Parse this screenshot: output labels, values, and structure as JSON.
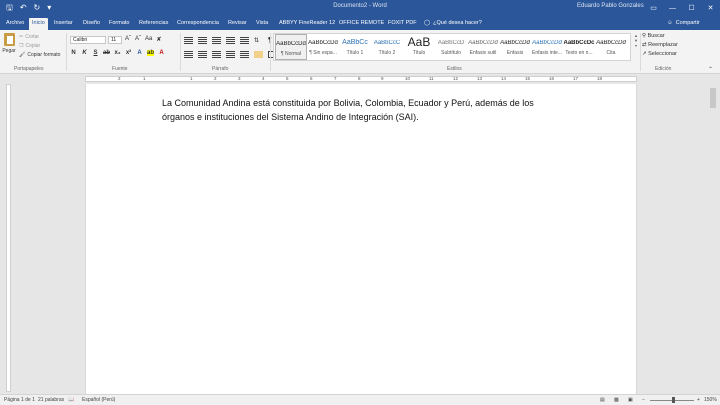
{
  "titlebar": {
    "doc_title": "Documento2 - Word",
    "user": "Eduardo Pablo Gonzales",
    "qat_icons": [
      "save-icon",
      "undo-icon",
      "redo-icon",
      "customize-icon"
    ],
    "controls": [
      "▭",
      "—",
      "☐",
      "✕"
    ]
  },
  "tabs": [
    {
      "label": "Archivo"
    },
    {
      "label": "Inicio"
    },
    {
      "label": "Insertar"
    },
    {
      "label": "Diseño"
    },
    {
      "label": "Formato"
    },
    {
      "label": "Referencias"
    },
    {
      "label": "Correspondencia"
    },
    {
      "label": "Revisar"
    },
    {
      "label": "Vista"
    },
    {
      "label": "ABBYY FineReader 12"
    },
    {
      "label": "OFFICE REMOTE"
    },
    {
      "label": "FOXIT PDF"
    }
  ],
  "tell_me": "¿Qué desea hacer?",
  "share": "Compartir",
  "clipboard": {
    "paste": "Pegar",
    "cut": "Cortar",
    "copy": "Copiar",
    "format_painter": "Copiar formato",
    "group": "Portapapeles"
  },
  "font": {
    "name": "Calibri",
    "size": "11",
    "group": "Fuente",
    "bold": "N",
    "italic": "K",
    "underline": "S"
  },
  "paragraph": {
    "group": "Párrafo"
  },
  "styles": {
    "group": "Estilos",
    "items": [
      {
        "sample": "AaBbCcDd",
        "name": "¶ Normal"
      },
      {
        "sample": "AaBbCcDd",
        "name": "¶ Sin espa..."
      },
      {
        "sample": "AaBbCc",
        "name": "Título 1"
      },
      {
        "sample": "AaBbCcC",
        "name": "Título 2"
      },
      {
        "sample": "AaB",
        "name": "Título"
      },
      {
        "sample": "AaBbCcD",
        "name": "Subtítulo"
      },
      {
        "sample": "AaBbCcDd",
        "name": "Énfasis sutil"
      },
      {
        "sample": "AaBbCcDd",
        "name": "Énfasis"
      },
      {
        "sample": "AaBbCcDd",
        "name": "Énfasis inte..."
      },
      {
        "sample": "AaBbCcDc",
        "name": "Texto en n..."
      },
      {
        "sample": "AaBbCcDd",
        "name": "Cita"
      }
    ]
  },
  "editing": {
    "find": "Buscar",
    "replace": "Reemplazar",
    "select": "Seleccionar",
    "group": "Edición"
  },
  "ruler_numbers": [
    "2",
    "1",
    "1",
    "2",
    "3",
    "4",
    "5",
    "6",
    "7",
    "8",
    "9",
    "10",
    "11",
    "12",
    "13",
    "14",
    "15",
    "16",
    "17",
    "18"
  ],
  "document": {
    "text": "La Comunidad Andina está constituida por Bolivia, Colombia, Ecuador y Perú, además de los órganos e instituciones del Sistema Andino de Integración (SAI)."
  },
  "status": {
    "page": "Página 1 de 1",
    "words": "21 palabras",
    "language": "Español (Perú)",
    "zoom": "150%"
  }
}
